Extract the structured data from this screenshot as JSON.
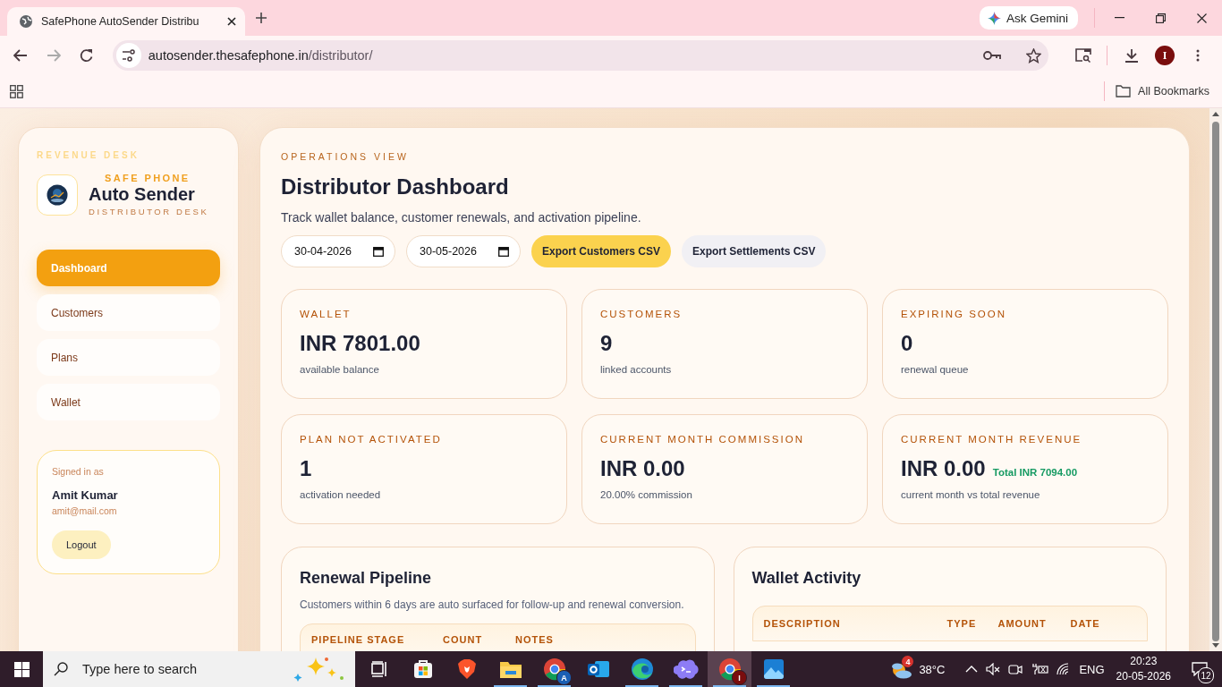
{
  "browser": {
    "tab_title": "SafePhone AutoSender Distribu",
    "url_host": "autosender.thesafephone.in",
    "url_path": "/distributor/",
    "gemini_label": "Ask Gemini",
    "profile_initial": "I",
    "bookmarks_label": "All Bookmarks"
  },
  "sidebar": {
    "eyebrow": "REVENUE DESK",
    "brand_top": "SAFE PHONE",
    "brand_name": "Auto Sender",
    "brand_sub": "DISTRIBUTOR DESK",
    "nav": [
      {
        "label": "Dashboard",
        "selected": true
      },
      {
        "label": "Customers",
        "selected": false
      },
      {
        "label": "Plans",
        "selected": false
      },
      {
        "label": "Wallet",
        "selected": false
      }
    ],
    "user": {
      "caption": "Signed in as",
      "name": "Amit Kumar",
      "email": "amit@mail.com",
      "logout": "Logout"
    }
  },
  "main": {
    "eyebrow": "OPERATIONS VIEW",
    "title": "Distributor Dashboard",
    "subtitle": "Track wallet balance, customer renewals, and activation pipeline.",
    "dates": [
      {
        "value": "30-04-2026"
      },
      {
        "value": "30-05-2026"
      }
    ],
    "buttons": [
      {
        "label": "Export Customers CSV",
        "kind": "primary"
      },
      {
        "label": "Export Settlements CSV",
        "kind": "secondary"
      }
    ],
    "stats": [
      {
        "label": "WALLET",
        "value": "INR 7801.00",
        "note": "available balance"
      },
      {
        "label": "CUSTOMERS",
        "value": "9",
        "note": "linked accounts"
      },
      {
        "label": "EXPIRING SOON",
        "value": "0",
        "note": "renewal queue"
      },
      {
        "label": "PLAN NOT ACTIVATED",
        "value": "1",
        "note": "activation needed"
      },
      {
        "label": "CURRENT MONTH COMMISSION",
        "value": "INR 0.00",
        "note": "20.00% commission"
      },
      {
        "label": "CURRENT MONTH REVENUE",
        "value": "INR 0.00",
        "extra": "Total INR 7094.00",
        "note": "current month vs total revenue"
      }
    ],
    "pipeline": {
      "title": "Renewal Pipeline",
      "description": "Customers within 6 days are auto surfaced for follow-up and renewal conversion.",
      "columns": [
        "PIPELINE STAGE",
        "COUNT",
        "NOTES"
      ]
    },
    "wallet_activity": {
      "title": "Wallet Activity",
      "columns": [
        "DESCRIPTION",
        "TYPE",
        "AMOUNT",
        "DATE"
      ]
    }
  },
  "taskbar": {
    "search_placeholder": "Type here to search",
    "apps": [
      {
        "kind": "taskview",
        "running": false,
        "selected": false
      },
      {
        "kind": "store",
        "running": false,
        "selected": false
      },
      {
        "kind": "brave",
        "running": false,
        "selected": false
      },
      {
        "kind": "files",
        "running": true,
        "selected": false
      },
      {
        "kind": "chrome",
        "badge": "A",
        "running": true,
        "selected": false
      },
      {
        "kind": "outlook",
        "running": false,
        "selected": false
      },
      {
        "kind": "edge",
        "running": true,
        "selected": false
      },
      {
        "kind": "terminal",
        "running": true,
        "selected": false
      },
      {
        "kind": "chrome",
        "badge": "I",
        "running": true,
        "selected": true
      },
      {
        "kind": "photos",
        "running": true,
        "selected": false
      }
    ],
    "weather_badge": "4",
    "temperature": "38°C",
    "language": "ENG",
    "time": "20:23",
    "date": "20-05-2026",
    "notifications": "12"
  }
}
